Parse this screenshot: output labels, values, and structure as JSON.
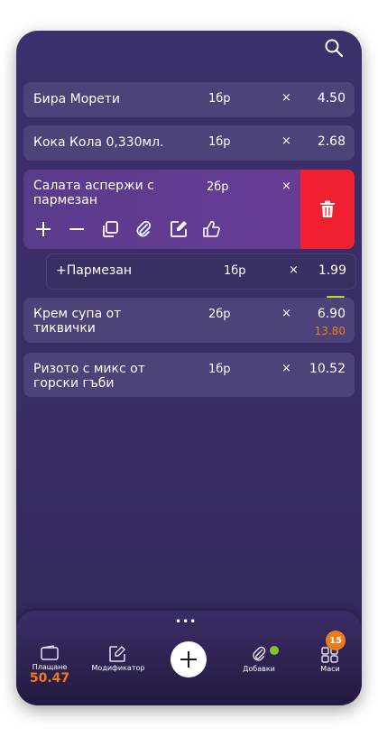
{
  "items": [
    {
      "name": "Бира Морети",
      "qty": "1бр",
      "x": "×",
      "price": "4.50"
    },
    {
      "name": "Кока Кола 0,330мл.",
      "qty": "1бр",
      "x": "×",
      "price": "2.68"
    },
    {
      "name": "Крем супа от тиквички",
      "qty": "2бр",
      "x": "×",
      "price": "6.90",
      "total": "13.80"
    },
    {
      "name": "Ризото с микс от горски гъби",
      "qty": "1бр",
      "x": "×",
      "price": "10.52"
    }
  ],
  "selected": {
    "name": "Салата аспержи с пармезан",
    "qty": "2бр",
    "x": "×"
  },
  "modifier": {
    "name": "+Пармезан",
    "qty": "1бр",
    "x": "×",
    "price": "1.99"
  },
  "bottom_nav": {
    "payment_label": "Плащане",
    "payment_amount": "50.47",
    "modifier_label": "Модификатор",
    "extras_label": "Добавки",
    "tables_label": "Маси",
    "tables_badge": "15",
    "more": "•••"
  },
  "colors": {
    "accent": "#f07a1a",
    "delete": "#f0202e",
    "status_green": "#b7e01f"
  }
}
